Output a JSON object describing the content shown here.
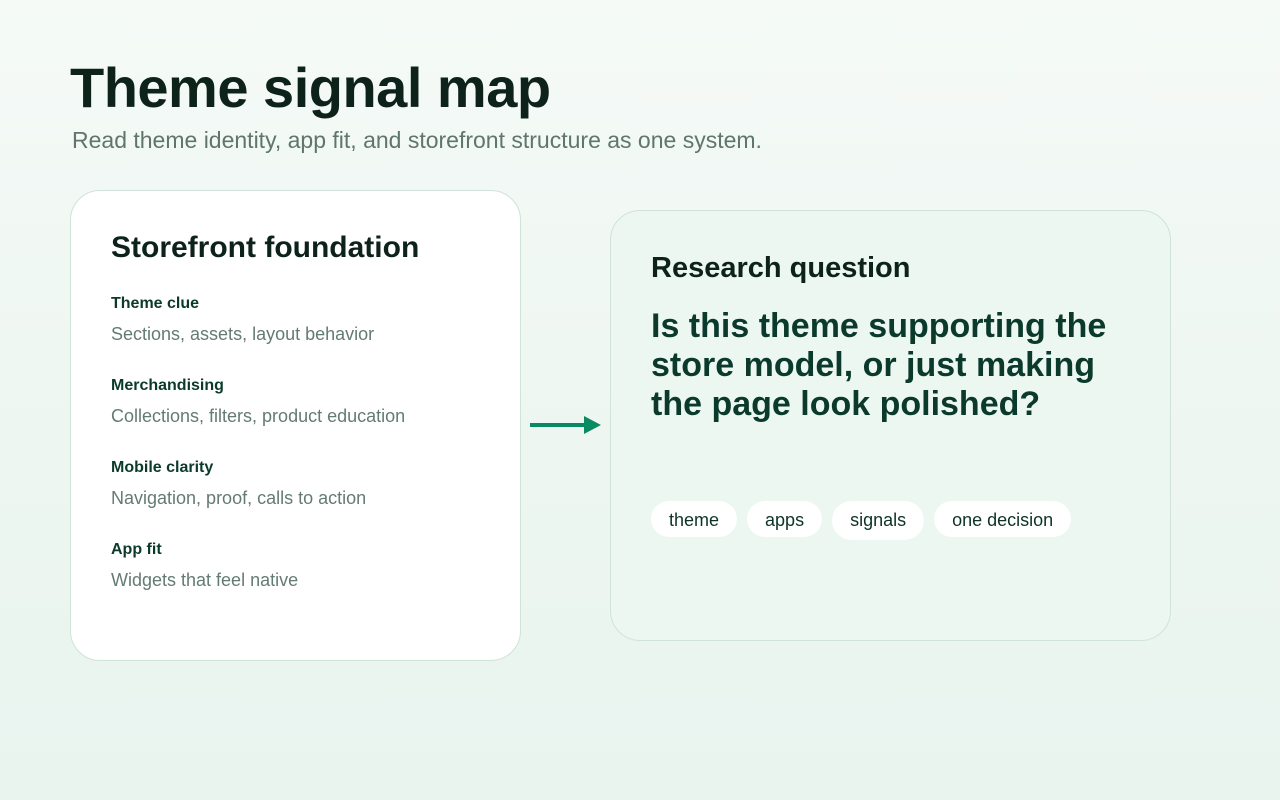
{
  "header": {
    "title": "Theme signal map",
    "subtitle": "Read theme identity, app fit, and storefront structure as one system."
  },
  "foundation_card": {
    "title": "Storefront foundation",
    "items": [
      {
        "label": "Theme clue",
        "text": "Sections, assets, layout behavior"
      },
      {
        "label": "Merchandising",
        "text": "Collections, filters, product education"
      },
      {
        "label": "Mobile clarity",
        "text": "Navigation, proof, calls to action"
      },
      {
        "label": "App fit",
        "text": "Widgets that feel native"
      }
    ]
  },
  "connector": {
    "icon": "arrow-right-icon",
    "color": "#0a8a62"
  },
  "question_card": {
    "title": "Research question",
    "question": "Is this theme supporting the store model, or just making the page look polished?",
    "tags": [
      "theme",
      "apps",
      "signals",
      "one decision"
    ]
  },
  "colors": {
    "accent": "#0a8a62",
    "heading": "#0e221c",
    "label": "#0b3a2d",
    "muted": "#647b73",
    "card_border": "#cfe3da",
    "question_card_bg": "#ecf7f1"
  }
}
